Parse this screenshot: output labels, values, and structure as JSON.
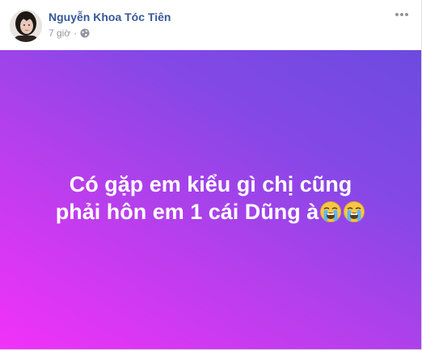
{
  "post": {
    "author": "Nguyễn Khoa Tóc Tiên",
    "time": "7 giờ",
    "separator": "·",
    "privacy_icon": "globe-icon",
    "menu_icon": "more-options-icon"
  },
  "status": {
    "line1": "Có gặp em kiểu gì chị cũng",
    "line2": "phải hôn em 1 cái Dũng à",
    "emojis": [
      "loudly-crying-face-icon",
      "loudly-crying-face-icon"
    ]
  },
  "colors": {
    "author": "#365899",
    "meta": "#90949c",
    "gradient_start": "#f331f9",
    "gradient_end": "#6c4be0",
    "status_text": "#ffffff"
  }
}
